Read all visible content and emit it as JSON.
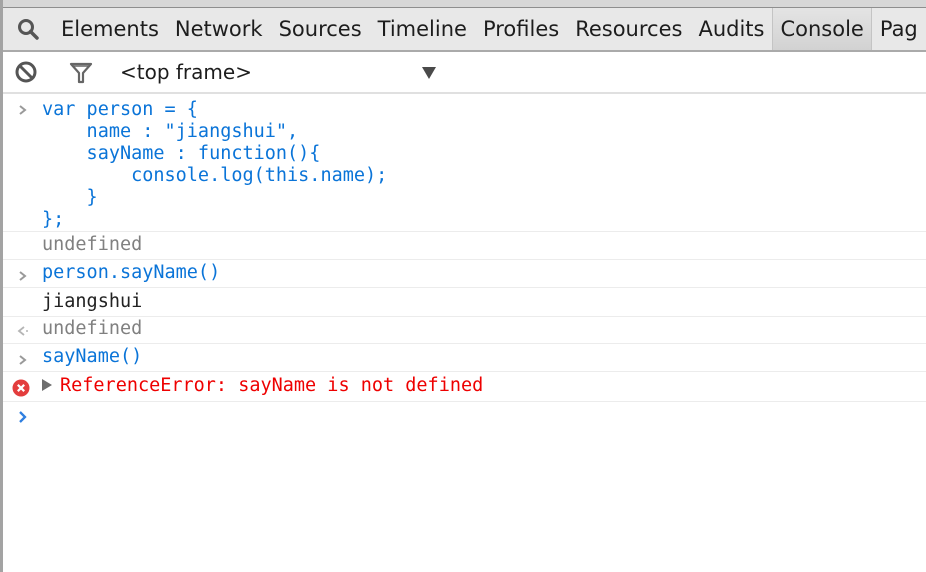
{
  "tabbar": {
    "search_icon": "search-icon",
    "tabs": [
      {
        "label": "Elements",
        "active": false
      },
      {
        "label": "Network",
        "active": false
      },
      {
        "label": "Sources",
        "active": false
      },
      {
        "label": "Timeline",
        "active": false
      },
      {
        "label": "Profiles",
        "active": false
      },
      {
        "label": "Resources",
        "active": false
      },
      {
        "label": "Audits",
        "active": false
      },
      {
        "label": "Console",
        "active": true
      },
      {
        "label": "Pag",
        "active": false
      }
    ]
  },
  "toolbar": {
    "clear_icon": "clear-console-icon",
    "filter_icon": "filter-icon",
    "frame_selector": "<top frame>",
    "frame_dropdown_icon": "dropdown-arrow-icon"
  },
  "console": {
    "messages": [
      {
        "type": "input",
        "icon": "input-chevron-icon",
        "text": "var person = {\n    name : \"jiangshui\",\n    sayName : function(){\n        console.log(this.name);\n    }\n};"
      },
      {
        "type": "result",
        "icon": "",
        "text": "undefined"
      },
      {
        "type": "input",
        "icon": "input-chevron-icon",
        "text": "person.sayName()"
      },
      {
        "type": "log",
        "icon": "",
        "text": "jiangshui"
      },
      {
        "type": "result",
        "icon": "result-arrow-icon",
        "text": "undefined"
      },
      {
        "type": "input",
        "icon": "input-chevron-icon",
        "text": "sayName()"
      },
      {
        "type": "error",
        "icon": "error-icon",
        "text": "ReferenceError: sayName is not defined"
      }
    ],
    "prompt_icon": "prompt-chevron-icon",
    "prompt_value": ""
  },
  "colors": {
    "input": "#0a74d8",
    "error": "#ee0000",
    "result": "#808080",
    "log": "#222222"
  }
}
